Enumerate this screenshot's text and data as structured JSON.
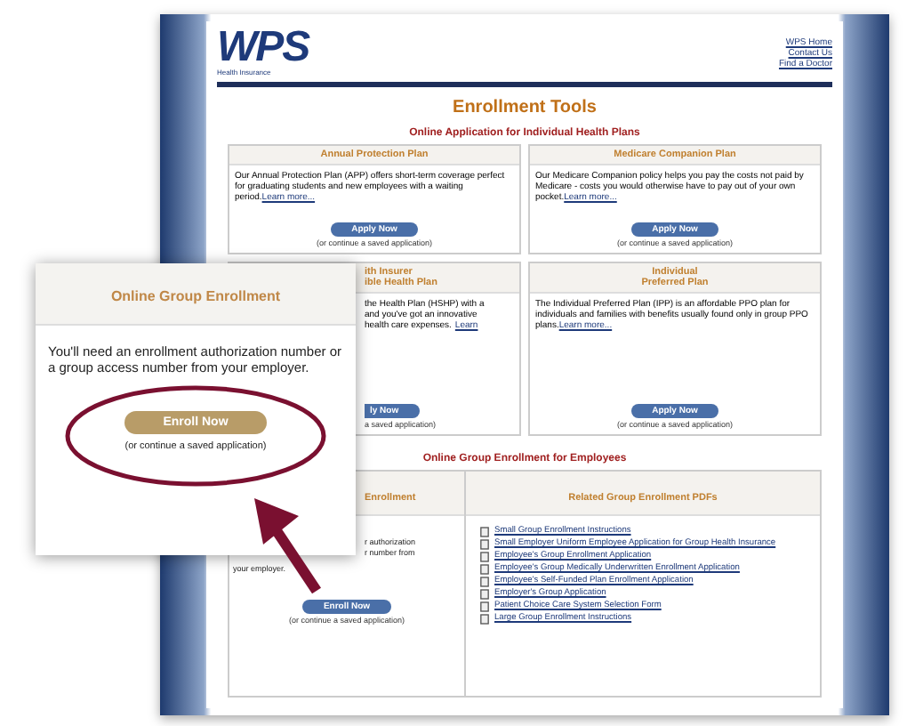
{
  "header": {
    "logo": "WPS",
    "logo_tagline": "Health Insurance",
    "links": [
      "WPS Home",
      "Contact Us",
      "Find a Doctor"
    ]
  },
  "title": "Enrollment Tools",
  "individual_section": {
    "heading": "Online Application for Individual Health Plans",
    "plans": [
      {
        "kind": "full",
        "name_lines": [
          "Annual Protection Plan"
        ],
        "text_lines": [
          "Our Annual Protection Plan (APP) offers short-term coverage perfect for graduating students and new employees with a waiting period."
        ],
        "link": "Learn more...",
        "button": "Apply Now",
        "saved": "(or continue a saved application)"
      },
      {
        "kind": "full",
        "name_lines": [
          "Medicare Companion Plan"
        ],
        "text_lines": [
          "Our Medicare Companion policy helps you pay the costs not paid by Medicare - costs you would otherwise have to pay out of your own pocket."
        ],
        "link": "Learn more...",
        "button": "Apply Now",
        "saved": "(or continue a saved application)"
      },
      {
        "kind": "cut",
        "name_lines": [
          "ith Insurer",
          "ible Health Plan"
        ],
        "text_lines": [
          "the Health Plan (HSHP) with a",
          "and you've got an innovative",
          "health care expenses."
        ],
        "link": "Learn",
        "button": "ly Now",
        "saved": "a saved application)"
      },
      {
        "kind": "full",
        "name_lines": [
          "Individual",
          "Preferred Plan"
        ],
        "text_lines": [
          "The Individual Preferred Plan (IPP) is an affordable PPO plan for individuals and families with benefits usually found only in group PPO plans."
        ],
        "link": "Learn more...",
        "button": "Apply Now",
        "saved": "(or continue a saved application)"
      }
    ]
  },
  "group_section": {
    "heading": "Online Group Enrollment for Employees",
    "enroll_box": {
      "title": "Enrollment",
      "cut_lines": [
        "r authorization",
        "r number from"
      ],
      "text": "your employer.",
      "button": "Enroll Now",
      "saved": "(or continue a saved application)"
    },
    "pdfs": {
      "title": "Related Group Enrollment PDFs",
      "items": [
        "Small Group Enrollment Instructions",
        "Small Employer Uniform Employee Application for Group Health Insurance",
        "Employee's Group Enrollment Application",
        "Employee's Group Medically Underwritten Enrollment Application",
        "Employee's Self-Funded Plan Enrollment Application",
        "Employer's Group Application",
        "Patient Choice Care System Selection Form",
        "Large Group Enrollment Instructions"
      ]
    }
  },
  "callout": {
    "title": "Online Group Enrollment",
    "text": "You'll need an enrollment authorization number or a group access number from your employer.",
    "button": "Enroll Now",
    "saved": "(or continue a saved application)"
  }
}
